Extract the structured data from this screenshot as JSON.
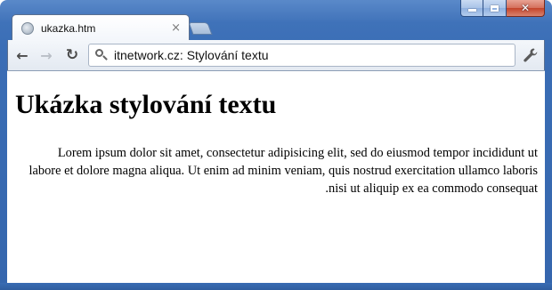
{
  "window": {
    "caption_buttons": {
      "minimize": "minimize-icon",
      "maximize": "maximize-icon",
      "close": "close-icon"
    },
    "frame_color": "#3f72b9"
  },
  "tabs": [
    {
      "title": "ukazka.htm",
      "icon": "globe-icon",
      "close_glyph": "×",
      "active": true
    }
  ],
  "toolbar": {
    "back_glyph": "←",
    "forward_glyph": "→",
    "reload_glyph": "↻",
    "omnibox_text": "itnetwork.cz: Stylování textu",
    "omnibox_icon": "search-icon",
    "menu_icon": "wrench-icon"
  },
  "page": {
    "heading": "Ukázka stylování textu",
    "paragraph_lines": [
      "Lorem ipsum dolor sit amet, consectetur adipisicing elit, sed do eiusmod tempor incididunt ut",
      "labore et dolore magna aliqua. Ut enim ad minim veniam, quis nostrud exercitation ullamco laboris",
      ".nisi ut aliquip ex ea commodo consequat"
    ],
    "text_align": "right",
    "direction": "rtl"
  }
}
